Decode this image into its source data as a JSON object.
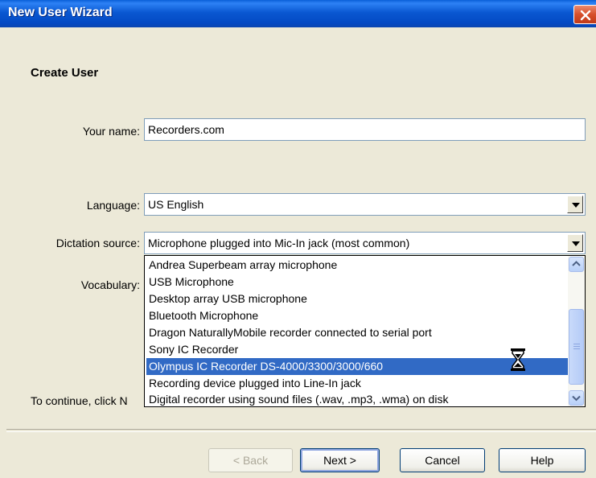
{
  "window": {
    "title": "New User Wizard"
  },
  "page": {
    "heading": "Create User"
  },
  "form": {
    "name_label": "Your name:",
    "name_value": "Recorders.com",
    "language_label": "Language:",
    "language_value": "US English",
    "source_label": "Dictation source:",
    "source_value": "Microphone plugged into Mic-In jack (most common)",
    "vocabulary_label": "Vocabulary:"
  },
  "dropdown": {
    "items": [
      "Andrea Superbeam array microphone",
      "USB Microphone",
      "Desktop array USB microphone",
      "Bluetooth Microphone",
      "Dragon NaturallyMobile recorder connected to serial port",
      "Sony IC Recorder",
      "Olympus IC Recorder DS-4000/3300/3000/660",
      "Recording device plugged into Line-In jack",
      "Digital recorder using sound files (.wav, .mp3, .wma) on disk"
    ],
    "selected_index": 6
  },
  "footer": {
    "continue_text": "To continue, click N",
    "back_label": "< Back",
    "next_label": "Next >",
    "cancel_label": "Cancel",
    "help_label": "Help"
  },
  "colors": {
    "title_bar": "#0a58d2",
    "selection": "#316ac5",
    "dialog_bg": "#ece9d8"
  }
}
